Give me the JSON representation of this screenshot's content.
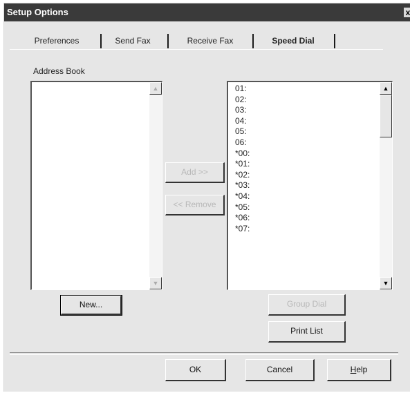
{
  "window": {
    "title": "Setup Options",
    "close_glyph": "x"
  },
  "tabs": [
    {
      "label": "Preferences",
      "active": false
    },
    {
      "label": "Send Fax",
      "active": false
    },
    {
      "label": "Receive Fax",
      "active": false
    },
    {
      "label": "Speed Dial",
      "active": true
    }
  ],
  "address_book": {
    "label": "Address Book",
    "items": []
  },
  "middle_buttons": {
    "add": "Add >>",
    "remove": "<< Remove"
  },
  "new_button": "New...",
  "speed_dial": {
    "entries": [
      "01:",
      "02:",
      "03:",
      "04:",
      "05:",
      "06:",
      "*00:",
      "*01:",
      "*02:",
      "*03:",
      "*04:",
      "*05:",
      "*06:",
      "*07:"
    ]
  },
  "speed_dial_buttons": {
    "group_dial": "Group Dial",
    "print_list": "Print List"
  },
  "footer": {
    "ok": "OK",
    "cancel": "Cancel",
    "help_first": "H",
    "help_rest": "elp"
  },
  "icons": {
    "scroll_up": "up-arrow",
    "scroll_down": "down-arrow"
  }
}
